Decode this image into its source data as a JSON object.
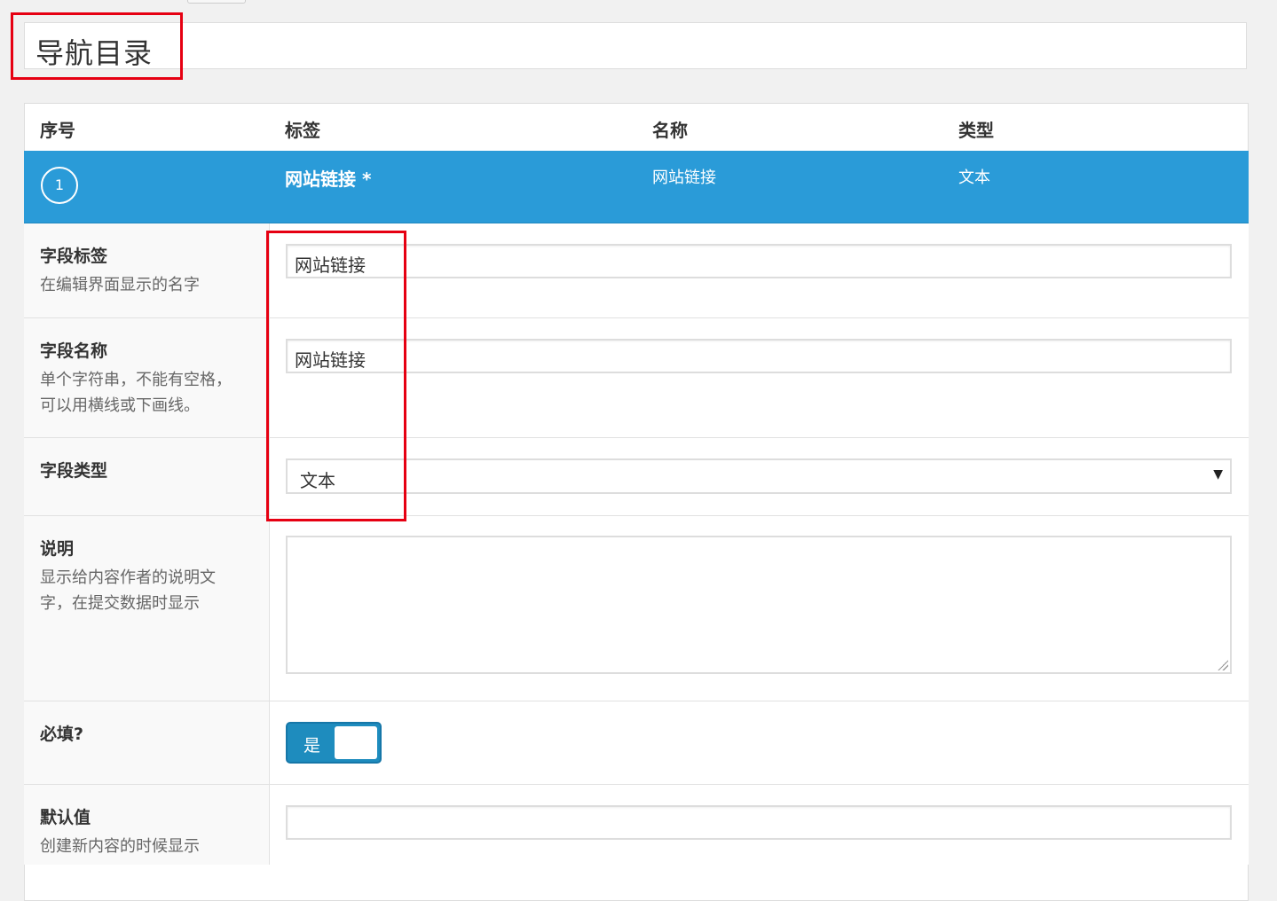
{
  "group_title": "导航目录",
  "table_headers": {
    "order": "序号",
    "label": "标签",
    "name": "名称",
    "type": "类型"
  },
  "field": {
    "order": "1",
    "label": "网站链接 *",
    "name": "网站链接",
    "type": "文本"
  },
  "settings": {
    "field_label": {
      "title": "字段标签",
      "desc": "在编辑界面显示的名字",
      "value": "网站链接"
    },
    "field_name": {
      "title": "字段名称",
      "desc_line1": "单个字符串，不能有空格，",
      "desc_line2": "可以用横线或下画线。",
      "value": "网站链接"
    },
    "field_type": {
      "title": "字段类型",
      "value": "文本"
    },
    "instructions": {
      "title": "说明",
      "desc_line1": "显示给内容作者的说明文",
      "desc_line2": "字，在提交数据时显示",
      "value": ""
    },
    "required": {
      "title": "必填?",
      "toggle_label": "是"
    },
    "default_value": {
      "title": "默认值",
      "desc": "创建新内容的时候显示",
      "value": ""
    }
  },
  "colors": {
    "accent": "#2a9bd8",
    "highlight": "#e60012"
  }
}
